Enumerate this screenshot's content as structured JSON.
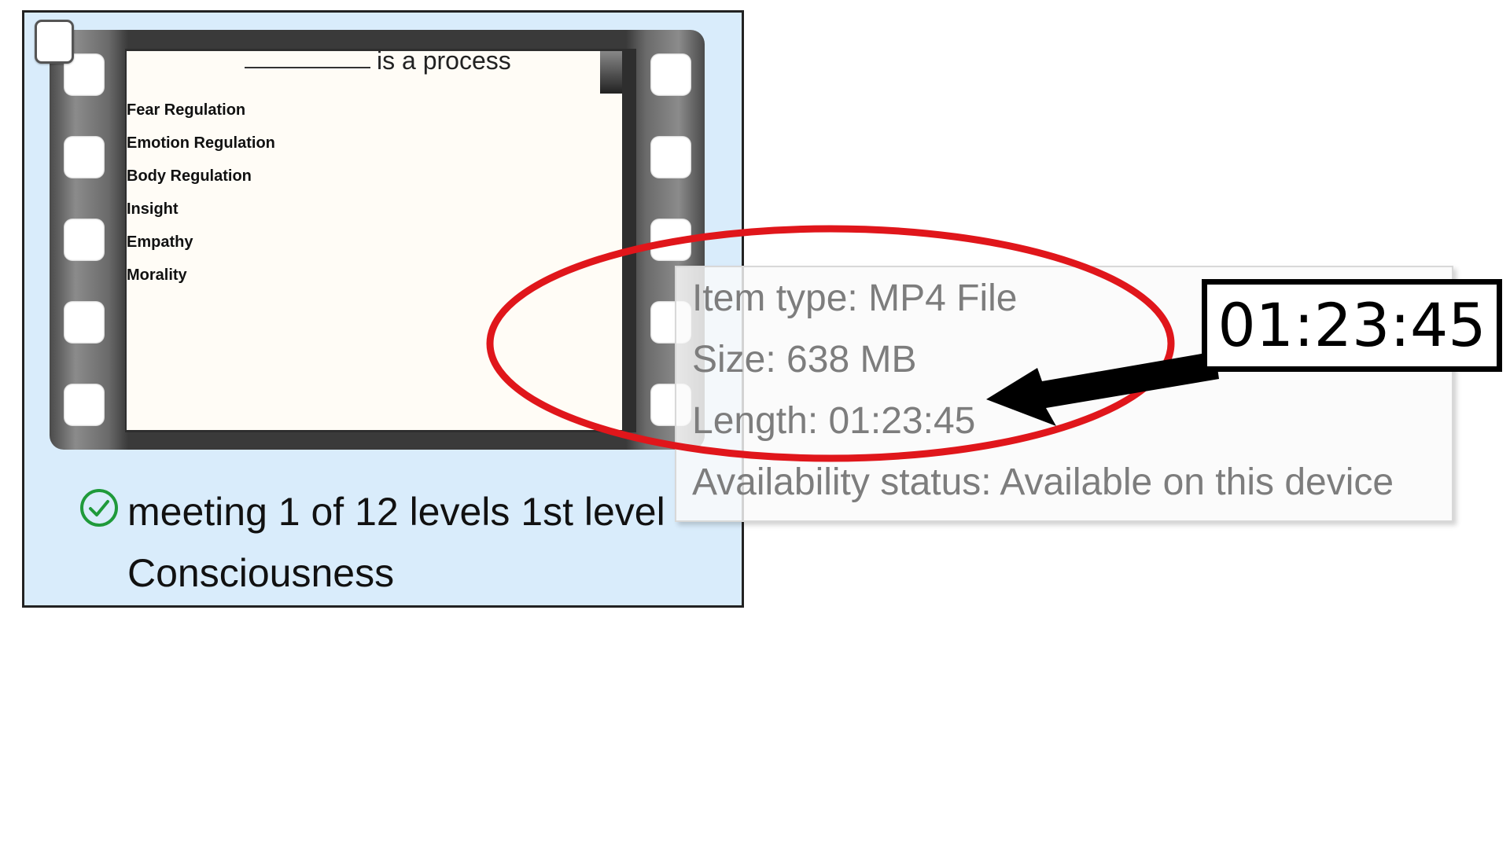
{
  "file_tile": {
    "slide": {
      "title": "is a process",
      "items": [
        "Fear Regulation",
        "Emotion Regulation",
        "Body Regulation",
        "Insight",
        "Empathy",
        "Morality"
      ]
    },
    "name_line1": "meeting 1 of 12 levels 1st level",
    "name_line2": "Consciousness",
    "status_icon": "green-check-circle-icon"
  },
  "tooltip": {
    "item_type": "Item type: MP4 File",
    "size": "Size: 638 MB",
    "length": "Length: 01:23:45",
    "availability": "Availability status: Available on this device"
  },
  "annotation": {
    "callout": "01:23:45",
    "ellipse_color": "#e0161b",
    "arrow_color": "#000000"
  }
}
